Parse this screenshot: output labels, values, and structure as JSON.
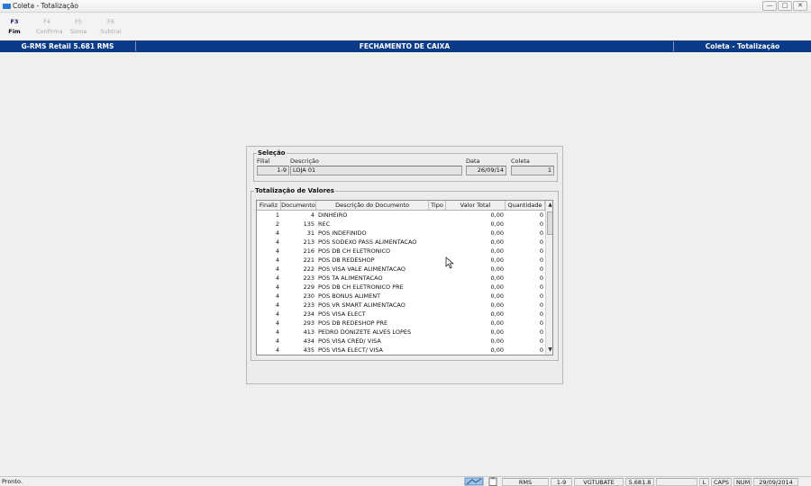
{
  "window": {
    "title": "Coleta - Totalização",
    "icon": "app-icon",
    "controls": {
      "minimize": "—",
      "maximize": "□",
      "close": "✕"
    }
  },
  "fkeys": [
    {
      "key": "F3",
      "label": "Fim",
      "enabled": true
    },
    {
      "key": "F4",
      "label": "Confirma",
      "enabled": false
    },
    {
      "key": "F5",
      "label": "Soma",
      "enabled": false
    },
    {
      "key": "F6",
      "label": "Subtrai",
      "enabled": false
    }
  ],
  "header": {
    "left": "G-RMS Retail 5.681 RMS",
    "center": "FECHAMENTO DE CAIXA",
    "right": "Coleta - Totalização",
    "color": "#0b3a86"
  },
  "selecao": {
    "legend": "Seleção",
    "filial_label": "Filial",
    "filial_value": "1-9",
    "descricao_label": "Descrição",
    "descricao_value": "LOJA 01",
    "data_label": "Data",
    "data_value": "26/09/14",
    "coleta_label": "Coleta",
    "coleta_value": "1"
  },
  "totalizacao": {
    "legend": "Totalização de Valores",
    "columns": [
      "Finaliz",
      "Documento",
      "Descrição do Documento",
      "Tipo",
      "Valor Total",
      "Quantidade"
    ],
    "rows": [
      {
        "finaliz": "1",
        "documento": "4",
        "descricao": "DINHEIRO",
        "tipo": "",
        "valor": "0,00",
        "quantidade": "0"
      },
      {
        "finaliz": "2",
        "documento": "135",
        "descricao": "REC",
        "tipo": "",
        "valor": "0,00",
        "quantidade": "0"
      },
      {
        "finaliz": "4",
        "documento": "31",
        "descricao": "POS INDEFINIDO",
        "tipo": "",
        "valor": "0,00",
        "quantidade": "0"
      },
      {
        "finaliz": "4",
        "documento": "213",
        "descricao": "POS SODEXO PASS ALIMENTACAO",
        "tipo": "",
        "valor": "0,00",
        "quantidade": "0"
      },
      {
        "finaliz": "4",
        "documento": "216",
        "descricao": "POS DB CH ELETRONICO",
        "tipo": "",
        "valor": "0,00",
        "quantidade": "0"
      },
      {
        "finaliz": "4",
        "documento": "221",
        "descricao": "POS DB REDESHOP",
        "tipo": "",
        "valor": "0,00",
        "quantidade": "0"
      },
      {
        "finaliz": "4",
        "documento": "222",
        "descricao": "POS VISA VALE ALIMENTACAO",
        "tipo": "",
        "valor": "0,00",
        "quantidade": "0"
      },
      {
        "finaliz": "4",
        "documento": "223",
        "descricao": "POS TA ALIMENTACAO",
        "tipo": "",
        "valor": "0,00",
        "quantidade": "0"
      },
      {
        "finaliz": "4",
        "documento": "229",
        "descricao": "POS DB CH ELETRONICO PRE",
        "tipo": "",
        "valor": "0,00",
        "quantidade": "0"
      },
      {
        "finaliz": "4",
        "documento": "230",
        "descricao": "POS BONUS ALIMENT",
        "tipo": "",
        "valor": "0,00",
        "quantidade": "0"
      },
      {
        "finaliz": "4",
        "documento": "233",
        "descricao": "POS VR SMART ALIMENTACAO",
        "tipo": "",
        "valor": "0,00",
        "quantidade": "0"
      },
      {
        "finaliz": "4",
        "documento": "234",
        "descricao": "POS VISA ELECT",
        "tipo": "",
        "valor": "0,00",
        "quantidade": "0"
      },
      {
        "finaliz": "4",
        "documento": "293",
        "descricao": "POS DB REDESHOP PRE",
        "tipo": "",
        "valor": "0,00",
        "quantidade": "0"
      },
      {
        "finaliz": "4",
        "documento": "413",
        "descricao": "PEDRO DONIZETE ALVES LOPES",
        "tipo": "",
        "valor": "0,00",
        "quantidade": "0"
      },
      {
        "finaliz": "4",
        "documento": "434",
        "descricao": "POS VISA CRED/ VISA",
        "tipo": "",
        "valor": "0,00",
        "quantidade": "0"
      },
      {
        "finaliz": "4",
        "documento": "435",
        "descricao": "POS VISA ELECT/ VISA",
        "tipo": "",
        "valor": "0,00",
        "quantidade": "0"
      }
    ]
  },
  "status": {
    "message": "Pronto.",
    "icons": [
      "network-icon",
      "clipboard-icon"
    ],
    "fields": [
      "RMS",
      "1-9",
      "VGTUBATE",
      "5.681.8",
      "",
      "L",
      "CAPS",
      "NUM",
      "29/09/2014"
    ]
  }
}
